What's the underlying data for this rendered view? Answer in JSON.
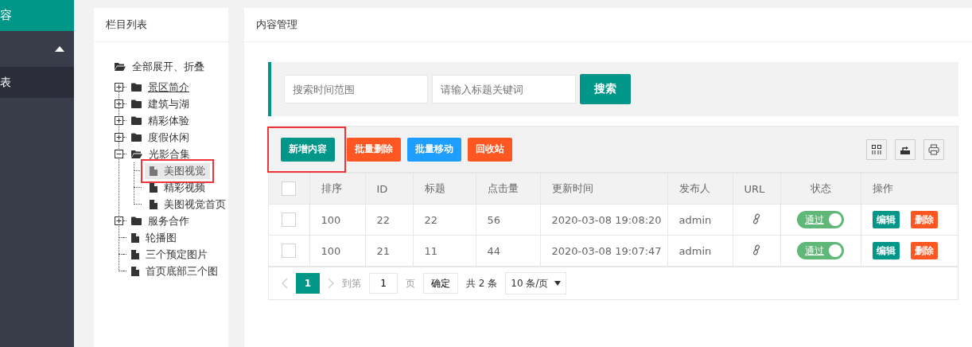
{
  "sidebar": {
    "title": "容",
    "items": [
      {
        "kind": "group",
        "expanded": true
      },
      {
        "kind": "link",
        "label": "表",
        "selected": true
      }
    ]
  },
  "tree_panel": {
    "title": "栏目列表",
    "toggle_all": "全部展开、折叠",
    "nodes": [
      {
        "label": "景区简介",
        "kind": "folder",
        "expanded": false,
        "selected": false,
        "hovered": true,
        "highlighted": false
      },
      {
        "label": "建筑与湖",
        "kind": "folder",
        "expanded": false,
        "selected": false,
        "hovered": false,
        "highlighted": false
      },
      {
        "label": "精彩体验",
        "kind": "folder",
        "expanded": false,
        "selected": false,
        "hovered": false,
        "highlighted": false
      },
      {
        "label": "度假休闲",
        "kind": "folder",
        "expanded": false,
        "selected": false,
        "hovered": false,
        "highlighted": false
      },
      {
        "label": "光影合集",
        "kind": "folder",
        "expanded": true,
        "selected": false,
        "hovered": false,
        "highlighted": false,
        "children": [
          {
            "label": "美图视觉",
            "kind": "file",
            "selected": true,
            "hovered": false,
            "highlighted": true
          },
          {
            "label": "精彩视频",
            "kind": "file",
            "selected": false,
            "hovered": false,
            "highlighted": false
          },
          {
            "label": "美图视觉首页",
            "kind": "file",
            "selected": false,
            "hovered": false,
            "highlighted": false
          }
        ]
      },
      {
        "label": "服务合作",
        "kind": "folder",
        "expanded": false,
        "selected": false,
        "hovered": false,
        "highlighted": false
      },
      {
        "label": "轮播图",
        "kind": "file",
        "selected": false,
        "hovered": false,
        "highlighted": false
      },
      {
        "label": "三个预定图片",
        "kind": "file",
        "selected": false,
        "hovered": false,
        "highlighted": false
      },
      {
        "label": "首页底部三个图",
        "kind": "file",
        "selected": false,
        "hovered": false,
        "highlighted": false
      }
    ]
  },
  "content": {
    "title": "内容管理",
    "search": {
      "date_placeholder": "搜索时间范围",
      "keyword_placeholder": "请输入标题关键词",
      "button": "搜索"
    },
    "actions": [
      {
        "label": "新增内容",
        "kind": "primary",
        "highlighted": true
      },
      {
        "label": "批量删除",
        "kind": "danger",
        "highlighted": false
      },
      {
        "label": "批量移动",
        "kind": "info",
        "highlighted": false
      },
      {
        "label": "回收站",
        "kind": "danger",
        "highlighted": false
      }
    ],
    "table": {
      "select_all_checked": false,
      "columns": [
        "排序",
        "ID",
        "标题",
        "点击量",
        "更新时间",
        "发布人",
        "URL",
        "状态",
        "操作"
      ],
      "rows": [
        {
          "checked": false,
          "sort": "100",
          "id": "22",
          "title": "22",
          "clicks": "56",
          "updated": "2020-03-08 19:08:20",
          "author": "admin",
          "status": "通过",
          "on": true,
          "edit": "编辑",
          "delete": "删除"
        },
        {
          "checked": false,
          "sort": "100",
          "id": "21",
          "title": "11",
          "clicks": "44",
          "updated": "2020-03-08 19:07:47",
          "author": "admin",
          "status": "通过",
          "on": true,
          "edit": "编辑",
          "delete": "删除"
        }
      ]
    },
    "pagination": {
      "pages": [
        {
          "label": "1",
          "selected": true
        }
      ],
      "goto_label": "到第",
      "page_value": "1",
      "page_unit": "页",
      "confirm": "确定",
      "total": "共 2 条",
      "page_size": "10 条/页"
    }
  }
}
